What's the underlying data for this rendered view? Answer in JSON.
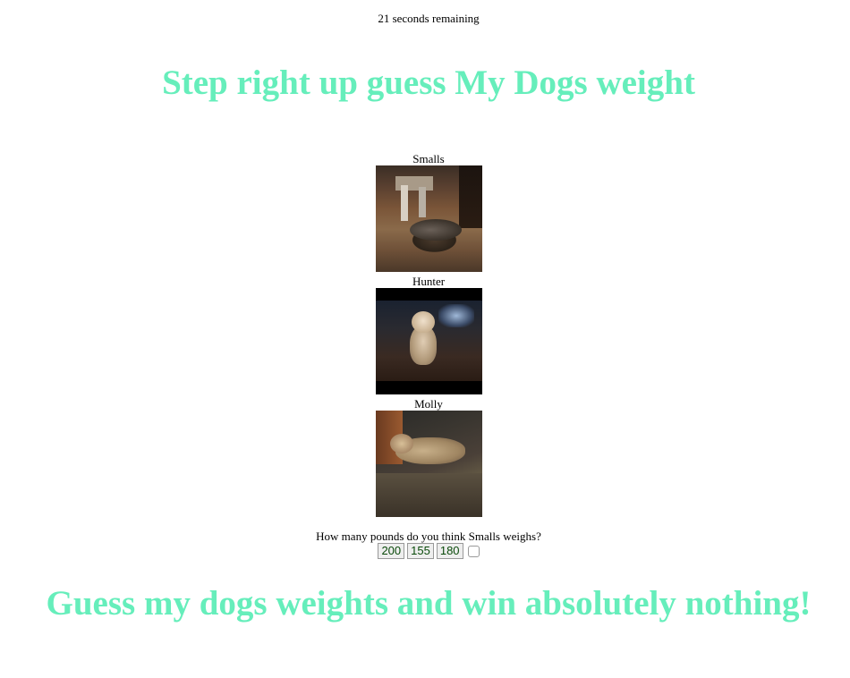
{
  "timer": {
    "text": "21 seconds remaining"
  },
  "header": {
    "title": "Step right up guess My Dogs weight"
  },
  "dogs": [
    {
      "name": "Smalls"
    },
    {
      "name": "Hunter"
    },
    {
      "name": "Molly"
    }
  ],
  "quiz": {
    "question": "How many pounds do you think Smalls weighs?",
    "options": [
      "200",
      "155",
      "180"
    ]
  },
  "footer": {
    "tagline": "Guess my dogs weights and win absolutely nothing!"
  },
  "colors": {
    "accent": "#66eebb",
    "button_text": "#0a4a0a"
  }
}
